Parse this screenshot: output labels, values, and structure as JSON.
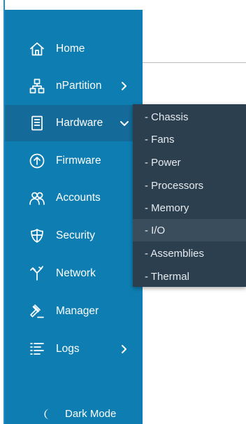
{
  "nav": {
    "items": [
      {
        "label": "Home",
        "icon": "home-icon"
      },
      {
        "label": "nPartition",
        "icon": "sitemap-icon",
        "chevron": "right"
      },
      {
        "label": "Hardware",
        "icon": "server-icon",
        "chevron": "down",
        "selected": true
      },
      {
        "label": "Firmware",
        "icon": "upload-circle-icon"
      },
      {
        "label": "Accounts",
        "icon": "users-icon"
      },
      {
        "label": "Security",
        "icon": "shield-icon"
      },
      {
        "label": "Network",
        "icon": "network-icon"
      },
      {
        "label": "Manager",
        "icon": "gavel-icon"
      },
      {
        "label": "Logs",
        "icon": "list-icon",
        "chevron": "right"
      }
    ],
    "dark_mode_label": "Dark Mode",
    "dark_mode_icon": "moon-icon"
  },
  "hardware_submenu": {
    "items": [
      "- Chassis",
      "- Fans",
      "- Power",
      "- Processors",
      "- Memory",
      "- I/O",
      "- Assemblies",
      "- Thermal"
    ],
    "active": "- I/O"
  },
  "colors": {
    "sidebar_bg": "#0e7eb2",
    "sidebar_selected_bg": "#146a99",
    "flyout_bg": "#2c3f4f",
    "flyout_active_bg": "#3a4d5d",
    "text": "#ffffff"
  }
}
